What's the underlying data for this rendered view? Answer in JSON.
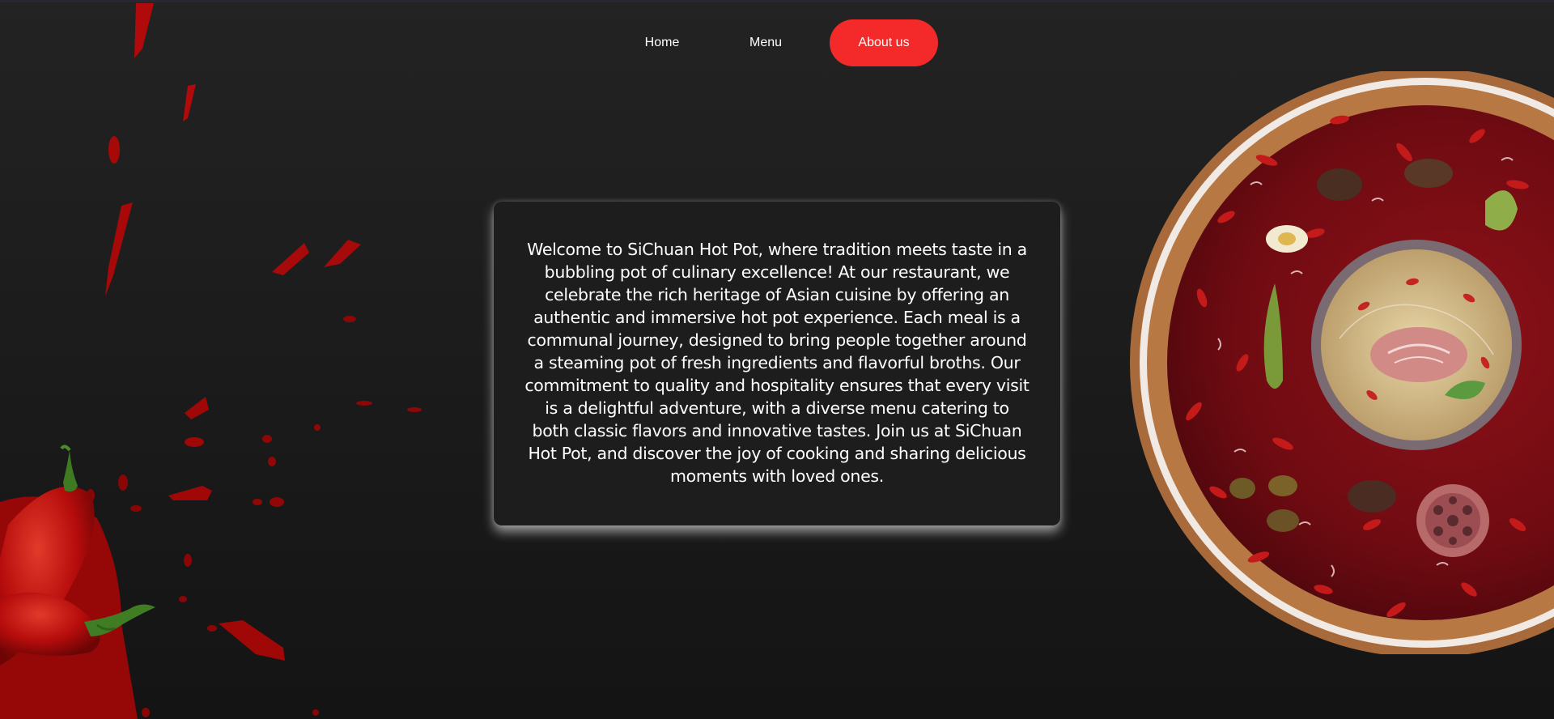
{
  "nav": {
    "items": [
      {
        "label": "Home",
        "active": false
      },
      {
        "label": "Menu",
        "active": false
      },
      {
        "label": "About us",
        "active": true
      }
    ],
    "active_color": "#f42a2a"
  },
  "about": {
    "text": "Welcome to SiChuan Hot Pot, where tradition meets taste in a bubbling pot of culinary excellence! At our restaurant, we celebrate the rich heritage of Asian cuisine by offering an authentic and immersive hot pot experience. Each meal is a communal journey, designed to bring people together around a steaming pot of fresh ingredients and flavorful broths. Our commitment to quality and hospitality ensures that every visit is a delightful adventure, with a diverse menu catering to both classic flavors and innovative tastes. Join us at SiChuan Hot Pot, and discover the joy of cooking and sharing delicious moments with loved ones."
  },
  "theme": {
    "background": "#1c1c1c",
    "card_background": "#1d1d1d",
    "accent": "#f42a2a",
    "chili_red": "#c40f0f"
  },
  "images": {
    "left_decor": "chili-splash-image",
    "right_decor": "hot-pot-image"
  }
}
